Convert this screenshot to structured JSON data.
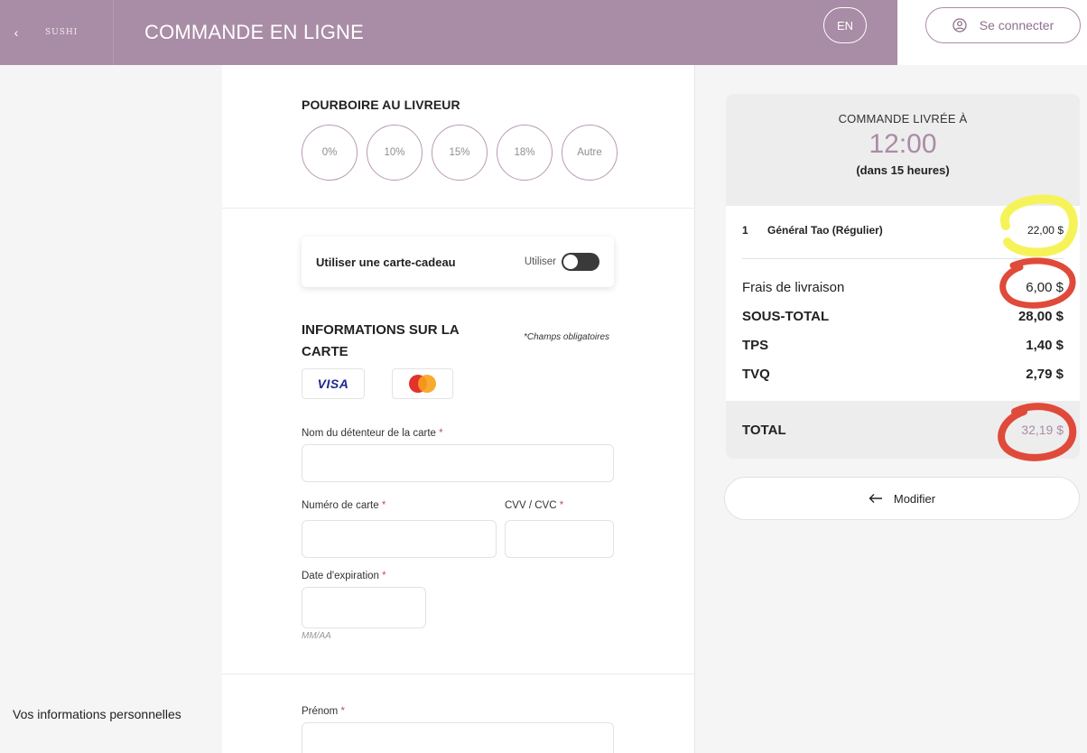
{
  "header": {
    "back_icon": "chevron-left-icon",
    "logo_text": "SUSHI",
    "title": "COMMANDE EN LIGNE",
    "lang_button": "EN",
    "login_label": "Se connecter",
    "login_icon": "user-circle-icon",
    "color": "#a98ca5"
  },
  "tips": {
    "title": "POURBOIRE AU LIVREUR",
    "options": [
      "0%",
      "10%",
      "15%",
      "18%",
      "Autre"
    ]
  },
  "gift_card": {
    "label": "Utiliser une carte-cadeau",
    "toggle_label": "Utiliser",
    "enabled": false
  },
  "card_info": {
    "title": "INFORMATIONS SUR LA CARTE",
    "required_note": "*Champs obligatoires",
    "brands": [
      "VISA",
      "mastercard"
    ],
    "holder_label": "Nom du détenteur de la carte",
    "number_label": "Numéro de carte",
    "cvv_label": "CVV / CVC",
    "expiry_label": "Date d'expiration",
    "expiry_hint": "MM/AA",
    "required_mark": "*"
  },
  "personal": {
    "section_label": "Vos informations personnelles",
    "first_name_label": "Prénom"
  },
  "summary": {
    "delivered_label": "COMMANDE LIVRÉE À",
    "time": "12:00",
    "relative": "(dans 15 heures)",
    "items": [
      {
        "qty": "1",
        "name": "Général Tao (Régulier)",
        "price": "22,00 $"
      }
    ],
    "delivery_fee_label": "Frais de livraison",
    "delivery_fee": "6,00 $",
    "subtotal_label": "SOUS-TOTAL",
    "subtotal": "28,00 $",
    "tps_label": "TPS",
    "tps": "1,40 $",
    "tvq_label": "TVQ",
    "tvq": "2,79 $",
    "total_label": "TOTAL",
    "total": "32,19 $",
    "accent_color": "#a98ca5"
  },
  "modify_button": {
    "label": "Modifier",
    "icon": "arrow-left-icon"
  },
  "annotations": {
    "highlight_color": "#f6f35a",
    "circle_color": "#e04a3a"
  }
}
